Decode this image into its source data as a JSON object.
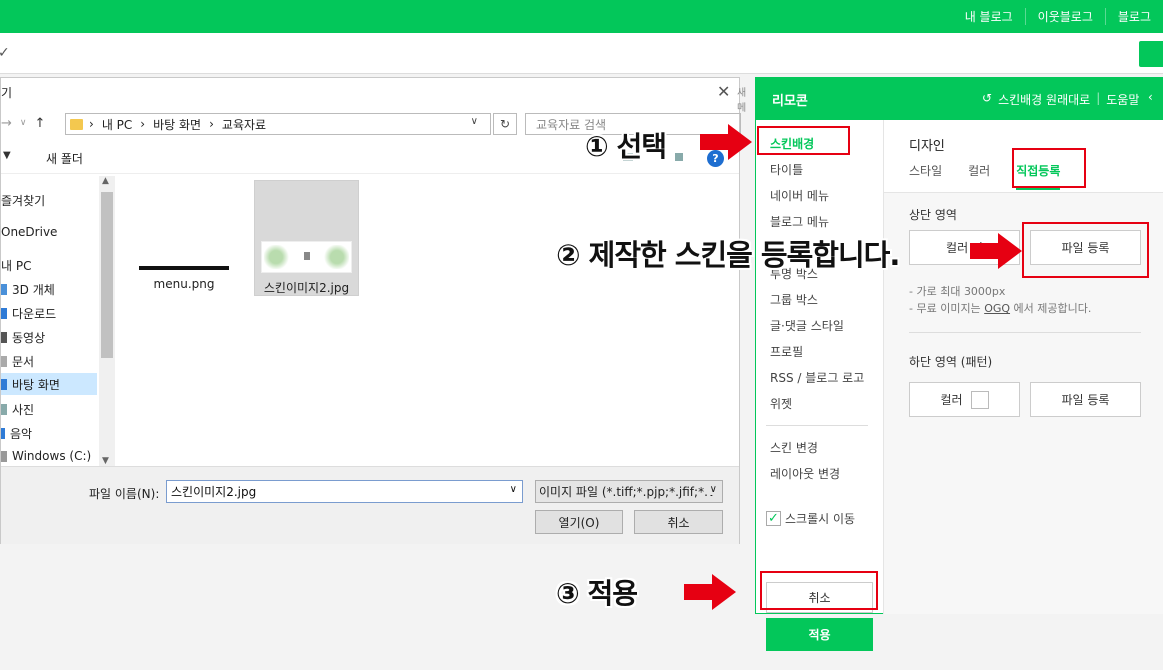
{
  "topbar": {
    "links": [
      "내 블로그",
      "이웃블로그",
      "블로그"
    ]
  },
  "dialog": {
    "title": "기",
    "side_text": "새 메",
    "address": [
      "내 PC",
      "바탕 화면",
      "교육자료"
    ],
    "search_placeholder": "교육자료 검색",
    "new_folder": "새 폴더",
    "tree": [
      {
        "label": "즐겨찾기",
        "icon": "star-icon"
      },
      {
        "label": "OneDrive",
        "icon": "cloud-icon"
      },
      {
        "label": "내 PC",
        "icon": "pc-icon"
      },
      {
        "label": "3D 개체",
        "icon": "cube-icon"
      },
      {
        "label": "다운로드",
        "icon": "download-icon"
      },
      {
        "label": "동영상",
        "icon": "video-icon"
      },
      {
        "label": "문서",
        "icon": "document-icon"
      },
      {
        "label": "바탕 화면",
        "icon": "desktop-icon"
      },
      {
        "label": "사진",
        "icon": "image-icon"
      },
      {
        "label": "음악",
        "icon": "music-icon"
      },
      {
        "label": "Windows (C:)",
        "icon": "drive-icon"
      }
    ],
    "files": [
      {
        "name": "menu.png"
      },
      {
        "name": "스킨이미지2.jpg"
      }
    ],
    "filename_label": "파일 이름(N):",
    "filename_value": "스킨이미지2.jpg",
    "filetype_value": "이미지 파일 (*.tiff;*.pjp;*.jfif;*.v",
    "open_label": "열기(O)",
    "cancel_label": "취소"
  },
  "remocon": {
    "title": "리모콘",
    "reset_label": "스킨배경 원래대로",
    "help_label": "도움말",
    "menu": [
      {
        "label": "스킨배경",
        "active": true
      },
      {
        "label": "타이틀",
        "active": false
      },
      {
        "label": "네이버 메뉴",
        "active": false
      },
      {
        "label": "블로그 메뉴",
        "active": false
      },
      {
        "label": "투명 박스",
        "active": false
      },
      {
        "label": "그룹 박스",
        "active": false
      },
      {
        "label": "글·댓글 스타일",
        "active": false
      },
      {
        "label": "프로필",
        "active": false
      },
      {
        "label": "RSS / 블로그 로고",
        "active": false
      },
      {
        "label": "위젯",
        "active": false
      },
      {
        "label": "스킨 변경",
        "active": false
      },
      {
        "label": "레이아웃 변경",
        "active": false
      }
    ],
    "scroll_move": "스크롤시 이동",
    "cancel": "취소",
    "apply": "적용",
    "heading": "디자인",
    "tabs": [
      "스타일",
      "컬러",
      "직접등록"
    ],
    "top_area": "상단 영역",
    "top_btn_left": "컬러 이",
    "top_btn_right": "파일 등록",
    "note1": "- 가로 최대 3000px",
    "note2_pre": "- 무료 이미지는 ",
    "note2_link": "OGQ",
    "note2_post": " 에서 제공합니다.",
    "bottom_area": "하단 영역 (패턴)",
    "bottom_btn_left": "컬러",
    "bottom_btn_right": "파일 등록"
  },
  "annotations": {
    "step1": "① 선택",
    "step2": "② 제작한 스킨을 등록합니다.",
    "step3": "③ 적용"
  },
  "colors": {
    "brand_green": "#03c75a",
    "annotation_red": "#e60012"
  }
}
